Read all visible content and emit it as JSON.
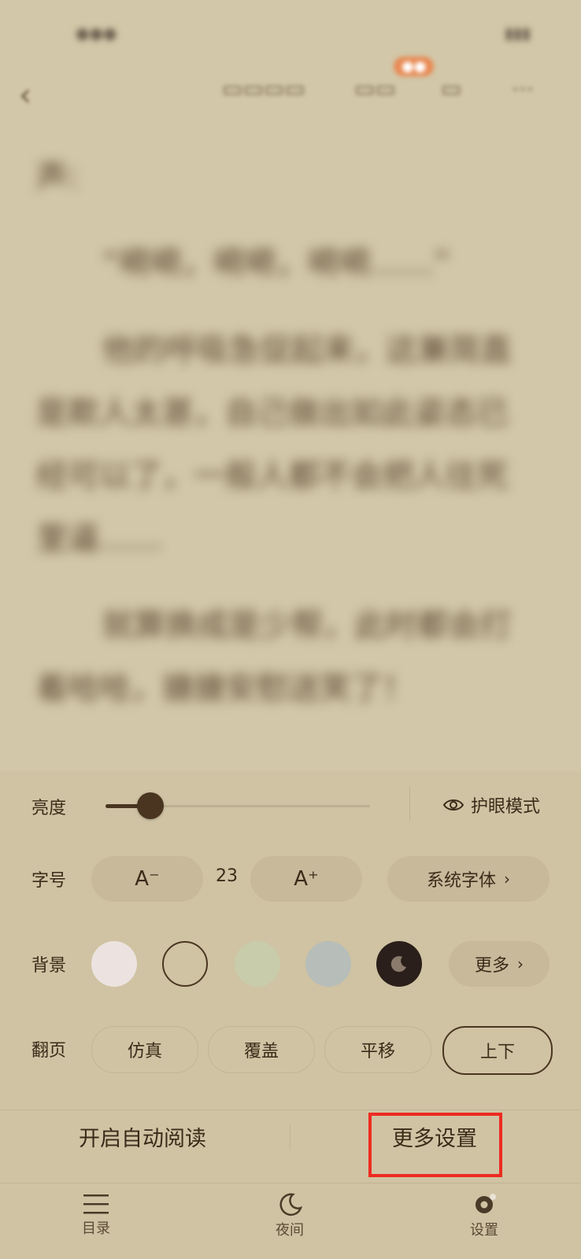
{
  "book": {
    "lines": [
      "声:",
      "“嗬嗬，嗬嗬，嗬嗬……”",
      "他的呼吸急促起来，这兼简直",
      "是欺人太甚，自己做出如此姿态已",
      "经可以了，一般人都不会把人往死",
      "里逼……",
      "就算换成是少帮，此时都会打",
      "着哈哈，搪搪安慰送笑了！"
    ]
  },
  "settings": {
    "brightness": {
      "label": "亮度",
      "level": 0.17,
      "eye_mode_label": "护眼模式"
    },
    "font": {
      "label": "字号",
      "decrease_label": "A⁻",
      "increase_label": "A⁺",
      "size": "23",
      "font_button_label": "系统字体"
    },
    "background": {
      "label": "背景",
      "swatches": [
        "#ece3e0",
        "#cfc3a3",
        "#c8ccaa",
        "#b7bdb8",
        "#2a1f1a"
      ],
      "selected_index": 1,
      "more_label": "更多"
    },
    "page_turn": {
      "label": "翻页",
      "options": [
        "仿真",
        "覆盖",
        "平移",
        "上下"
      ],
      "selected_index": 3
    }
  },
  "actions": {
    "auto_read_label": "开启自动阅读",
    "more_settings_label": "更多设置"
  },
  "bottom_nav": {
    "items": [
      {
        "label": "目录",
        "icon": "menu-icon"
      },
      {
        "label": "夜间",
        "icon": "moon-icon"
      },
      {
        "label": "设置",
        "icon": "settings-icon"
      }
    ]
  },
  "colors": {
    "background": "#cfc3a3",
    "accent": "#4a3521",
    "highlight": "#ee2a20"
  }
}
